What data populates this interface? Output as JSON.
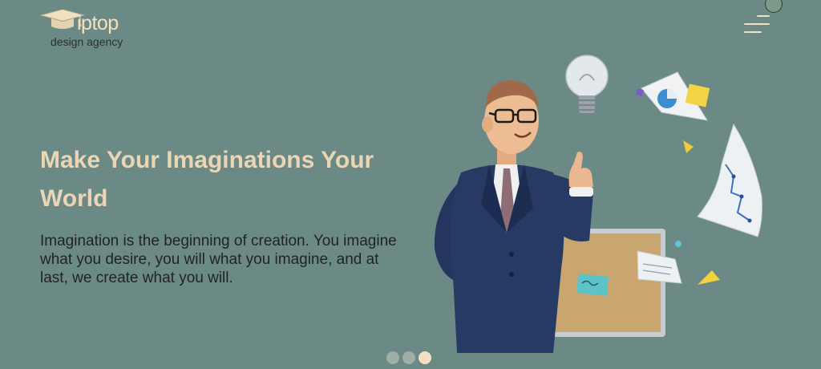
{
  "header": {
    "logo": {
      "wordmark": "iptop",
      "tagline": "design agency",
      "icon": "graduation-cap-icon"
    },
    "menu_icon": "hamburger-menu-icon"
  },
  "hero": {
    "title": "Make Your Imaginations Your World",
    "text": "Imagination is the beginning of creation. You imagine what you desire, you will what you imagine, and at last, we create what you will.",
    "illustration": "businessman-with-ideas-illustration"
  },
  "carousel": {
    "slide_count": 3,
    "active_index": 2
  },
  "colors": {
    "background": "#6b8a86",
    "title": "#ead6b5",
    "text": "#1f2322",
    "accent": "#f2e1c1",
    "dot_inactive": "#9fada7"
  }
}
